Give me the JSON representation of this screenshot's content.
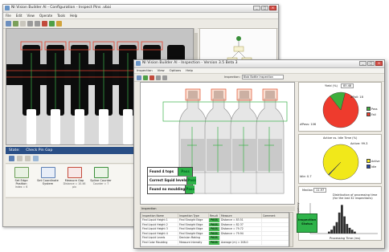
{
  "back_window": {
    "title": "NI Vision Builder AI - Configuration - Inspect Pins .vbai",
    "menu": [
      "File",
      "Edit",
      "View",
      "Operate",
      "Tools",
      "Help"
    ],
    "state_bar": {
      "label": "State:",
      "value": "Check Pin Gap"
    },
    "steps": [
      {
        "label": "Set Edge Position",
        "sub": "Index = 6"
      },
      {
        "label": "Set Coordinate System",
        "sub": ""
      },
      {
        "label": "Measure Gap",
        "sub": "Distance = 10.46 pix"
      },
      {
        "label": "Spline Counter",
        "sub": "Counter = 7"
      }
    ]
  },
  "front_window": {
    "title": "NI Vision Builder AI - Inspection - Version 3.5 Beta 3",
    "menu": [
      "Inspection",
      "View",
      "Options",
      "Help"
    ],
    "inspection_label": "Inspection:",
    "inspection_value": "Blob Bottle Inspection",
    "results_overlay": [
      {
        "label": "Found 4 tops",
        "status": "Pass"
      },
      {
        "label": "Correct liquid levels",
        "status": "Pass"
      },
      {
        "label": "Found no moulding",
        "status": "Pass"
      }
    ],
    "state_line": "Inspection",
    "table": {
      "headers": [
        "Inspection Name",
        "Inspection Type",
        "Result",
        "Measure",
        "Comment"
      ],
      "rows": [
        [
          "Find Liquid Height 1",
          "Find Straight Edge",
          "PASS",
          "Distance = 83.51",
          ""
        ],
        [
          "Find Liquid Height 2",
          "Find Straight Edge",
          "PASS",
          "Distance = 82.37",
          ""
        ],
        [
          "Find Liquid Height 3",
          "Find Straight Edge",
          "PASS",
          "Distance = 79.72",
          ""
        ],
        [
          "Find Liquid Height 4",
          "Find Straight Edge",
          "PASS",
          "Distance = 79.94",
          ""
        ],
        [
          "Find Liquid Levels",
          "Decision Making",
          "PASS",
          "",
          ""
        ],
        [
          "Find Color Moulding",
          "Measure Intensity",
          "PASS",
          "Average (m) = 208.0",
          ""
        ]
      ]
    },
    "inspection_status": {
      "line1": "Inspection",
      "line2": "Status"
    }
  },
  "chart_data": [
    {
      "type": "pie",
      "title": "Yield (%)",
      "title_value": "85.48",
      "labels": [
        "Pass",
        "Fail"
      ],
      "values": [
        85.48,
        14.52
      ],
      "slice_labels": [
        "#Pass: 106",
        "#Fail: 18"
      ],
      "colors": [
        "#ee3b2d",
        "#3fae3d"
      ]
    },
    {
      "type": "pie",
      "title": "Active vs. Idle Time (%)",
      "title_value": "Active: 99.3",
      "labels": [
        "Active",
        "Idle"
      ],
      "values": [
        99.3,
        0.7
      ],
      "slice_labels": [
        "Active: 99.3",
        "Idle: 0.7"
      ],
      "colors": [
        "#f1e81a",
        "#2745a7"
      ]
    },
    {
      "type": "bar",
      "title": "Distribution of processing time",
      "subtitle": "(for the last 32 inspections)",
      "stat_label": "Median",
      "stat_value": "11.97",
      "xlabel": "Processing Time (ms)",
      "ylabel": "Frequency",
      "categories": [
        "11.5",
        "11.6",
        "11.7",
        "11.8",
        "11.9",
        "12.0",
        "12.1",
        "12.2",
        "12.3",
        "12.4",
        "12.5"
      ],
      "values": [
        1,
        2,
        4,
        6,
        11,
        15,
        9,
        5,
        3,
        2,
        1
      ],
      "ylim": [
        0,
        16
      ],
      "bar_color": "#2f2f2f"
    }
  ]
}
